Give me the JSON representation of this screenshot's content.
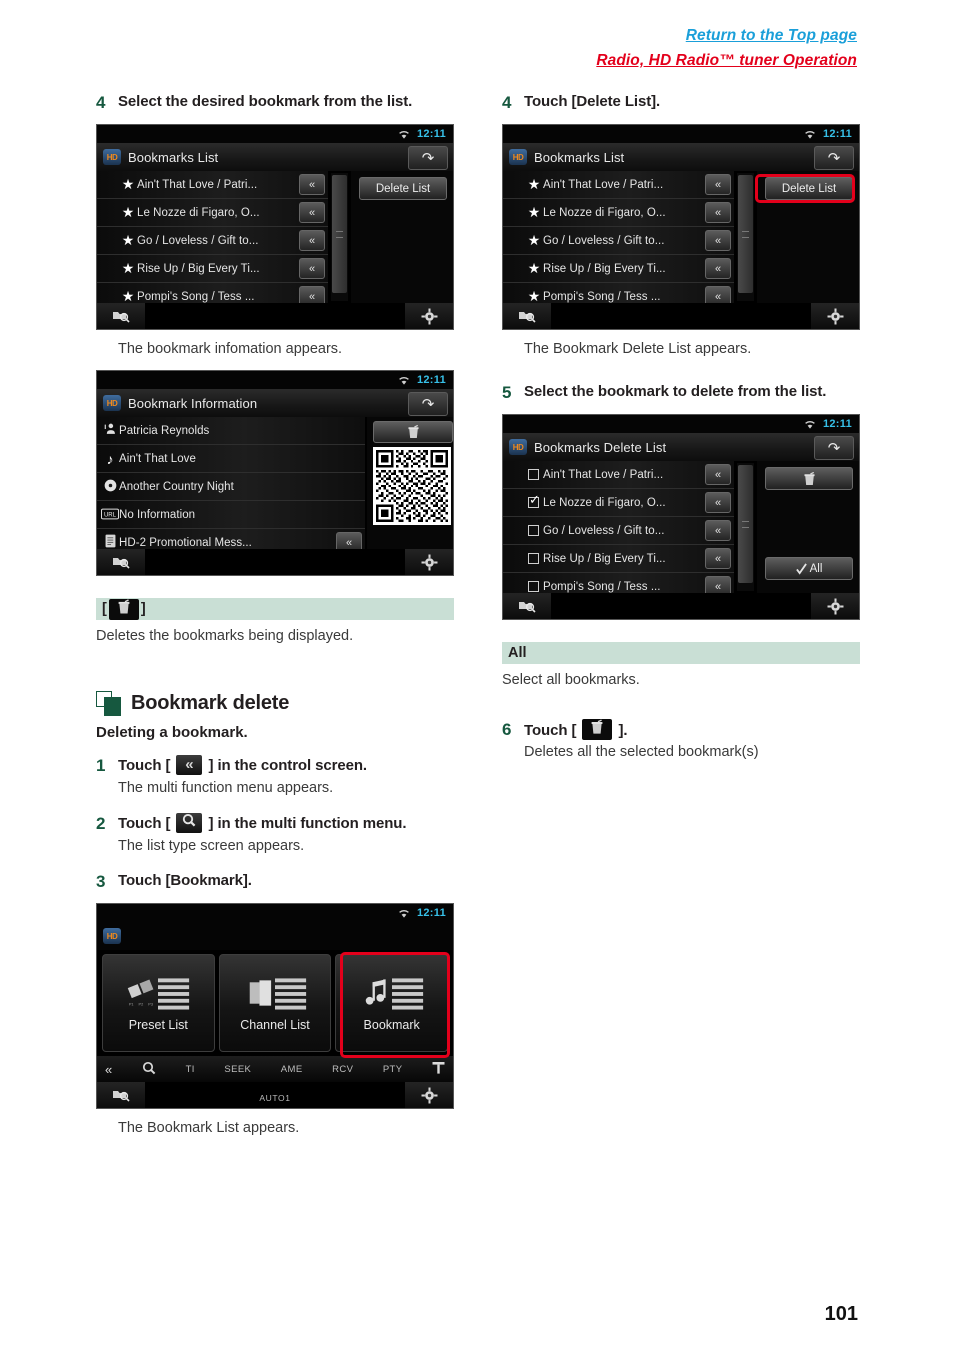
{
  "header": {
    "return_link": "Return to the Top page",
    "section": "Radio, HD Radio™ tuner Operation"
  },
  "page_number": "101",
  "left_column": {
    "step4": {
      "num": "4",
      "title": "Select the desired bookmark from the list.",
      "caption": "The bookmark infomation appears."
    },
    "bookmarks_list_screen": {
      "clock": "12:11",
      "title": "Bookmarks List",
      "back_icon": "back-arrow-icon",
      "hd_badge": "HD",
      "delete_list_button": "Delete List",
      "items": [
        "Ain't That Love / Patri...",
        "Le Nozze di Figaro, O...",
        "Go / Loveless / Gift to...",
        "Rise Up / Big Every Ti...",
        "Pompi's Song / Tess ..."
      ],
      "row_button": "«",
      "footer_left_icon": "list-search-icon",
      "footer_right_icon": "gear-icon"
    },
    "bookmark_info_screen": {
      "clock": "12:11",
      "title": "Bookmark Information",
      "rows": [
        {
          "icon": "artist-icon",
          "text": "Patricia Reynolds"
        },
        {
          "icon": "music-note-icon",
          "text": "Ain't That Love"
        },
        {
          "icon": "disc-icon",
          "text": "Another Country Night"
        },
        {
          "icon": "url-icon",
          "text": "No Information"
        },
        {
          "icon": "document-icon",
          "text": "HD-2 Promotional Mess..."
        }
      ],
      "row_button": "«",
      "trash_button_icon": "trash-icon",
      "qr_label": "qr-code-image"
    },
    "trash_def": {
      "bracket_open": "[",
      "bracket_close": "]",
      "icon": "trash-icon",
      "description": "Deletes the bookmarks being displayed."
    },
    "section": {
      "title": "Bookmark delete",
      "subtitle": "Deleting a bookmark."
    },
    "step1": {
      "num": "1",
      "title_before": "Touch [",
      "icon": "double-chevron-left-icon",
      "title_after": "] in the control screen.",
      "body": "The multi function menu appears."
    },
    "step2": {
      "num": "2",
      "title_before": "Touch [",
      "icon": "magnifier-icon",
      "title_after": "] in the multi function menu.",
      "body": "The list type screen appears."
    },
    "step3": {
      "num": "3",
      "title": "Touch [Bookmark].",
      "caption": "The Bookmark List appears."
    },
    "list_type_screen": {
      "clock": "12:11",
      "tiles": [
        {
          "label": "Preset List",
          "icon": "preset-list-icon"
        },
        {
          "label": "Channel List",
          "icon": "channel-list-icon"
        },
        {
          "label": "Bookmark",
          "icon": "bookmark-list-icon"
        }
      ],
      "function_bar": [
        "«",
        "search",
        "TI",
        "SEEK",
        "AME",
        "RCV",
        "PTY",
        "antenna"
      ],
      "auto_label": "AUTO1",
      "footer_left_icon": "list-search-icon",
      "footer_right_icon": "gear-icon"
    }
  },
  "right_column": {
    "step4": {
      "num": "4",
      "title": "Touch [Delete List].",
      "caption": "The Bookmark Delete List appears."
    },
    "bookmarks_list_screen": {
      "clock": "12:11",
      "title": "Bookmarks List",
      "delete_list_button": "Delete List",
      "items": [
        "Ain't That Love / Patri...",
        "Le Nozze di Figaro, O...",
        "Go / Loveless / Gift to...",
        "Rise Up / Big Every Ti...",
        "Pompi's Song / Tess ..."
      ],
      "row_button": "«",
      "footer_left_icon": "list-search-icon",
      "footer_right_icon": "gear-icon"
    },
    "step5": {
      "num": "5",
      "title": "Select the bookmark to delete from the list."
    },
    "delete_list_screen": {
      "clock": "12:11",
      "title": "Bookmarks Delete List",
      "items": [
        {
          "text": "Ain't That Love / Patri...",
          "checked": false
        },
        {
          "text": "Le Nozze di Figaro, O...",
          "checked": true
        },
        {
          "text": "Go / Loveless / Gift to...",
          "checked": false
        },
        {
          "text": "Rise Up / Big Every Ti...",
          "checked": false
        },
        {
          "text": "Pompi's Song / Tess ...",
          "checked": false
        }
      ],
      "row_button": "«",
      "trash_button_icon": "trash-icon",
      "all_button": "All",
      "footer_left_icon": "list-search-icon",
      "footer_right_icon": "gear-icon"
    },
    "all_def": {
      "term": "All",
      "description": "Select all bookmarks."
    },
    "step6": {
      "num": "6",
      "title_before": "Touch [",
      "icon": "trash-icon",
      "title_after": "].",
      "body": "Deletes all the selected bookmark(s)"
    }
  },
  "colors": {
    "link_blue": "#1a9fd9",
    "brand_red": "#e3001b",
    "green_bar": "#c9dfd5",
    "dark_green": "#16583f",
    "clock_cyan": "#37c0e8"
  }
}
